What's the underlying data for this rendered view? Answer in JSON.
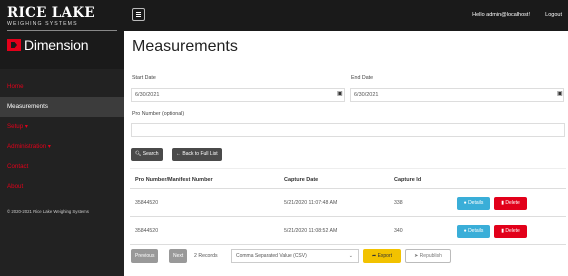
{
  "sidebar": {
    "logo_main": "RICE LAKE",
    "logo_sub": "WEIGHING SYSTEMS",
    "product": "Dimension",
    "items": [
      {
        "label": "Home"
      },
      {
        "label": "Measurements"
      },
      {
        "label": "Setup ▾"
      },
      {
        "label": "Administration ▾"
      },
      {
        "label": "Contact"
      },
      {
        "label": "About"
      }
    ],
    "copyright": "© 2020-2021 Rice Lake Weighing Systems"
  },
  "header": {
    "user_text": "Hello admin@localhost!",
    "logout": "Logout"
  },
  "main": {
    "title": "Measurements",
    "start_date_label": "Start Date",
    "start_date_value": "6/30/2021",
    "end_date_label": "End Date",
    "end_date_value": "6/30/2021",
    "pro_label": "Pro Number (optional)",
    "pro_value": "",
    "search_label": "Search",
    "back_label": "Back to Full List",
    "table": {
      "headers": [
        "Pro Number/Manifest Number",
        "Capture Date",
        "Capture Id"
      ],
      "rows": [
        {
          "pro": "35844520",
          "date": "5/21/2020 11:07:48 AM",
          "id": "338"
        },
        {
          "pro": "35844520",
          "date": "5/21/2020 11:08:52 AM",
          "id": "340"
        }
      ],
      "details_label": "Details",
      "delete_label": "Delete"
    },
    "footer": {
      "previous": "Previous",
      "next": "Next",
      "records": "2 Records",
      "format": "Comma Separated Value (CSV)",
      "export": "Export",
      "republish": "Republish"
    }
  },
  "colors": {
    "brand_red": "#e2001a",
    "sidebar_bg": "#222222",
    "details_blue": "#3aaed8",
    "export_yellow": "#f2c200"
  }
}
